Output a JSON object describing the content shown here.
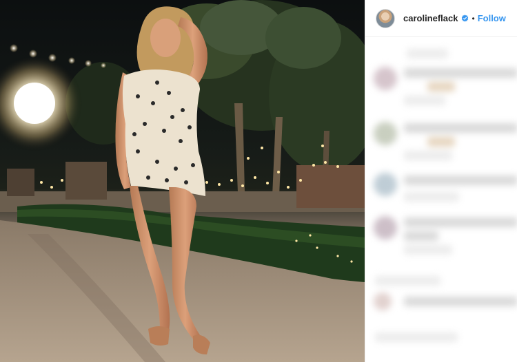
{
  "post": {
    "username": "carolineflack",
    "separator": "•",
    "follow_label": "Follow",
    "verified_icon": "verified-badge-icon",
    "colors": {
      "follow": "#3897f0",
      "verified": "#3897f0",
      "text": "#262626",
      "divider": "#efefef"
    }
  }
}
